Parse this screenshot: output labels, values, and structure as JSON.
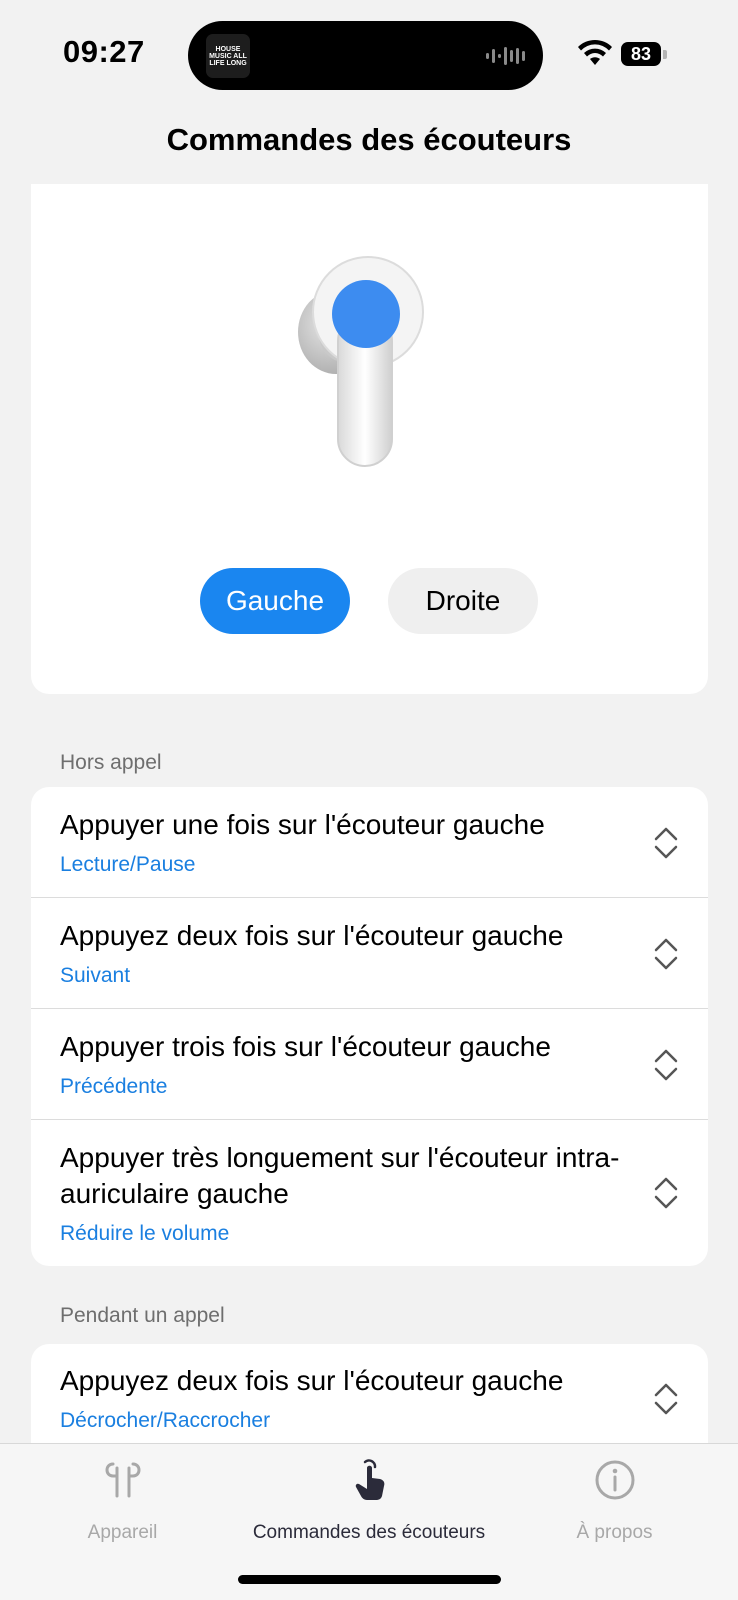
{
  "status_bar": {
    "time": "09:27",
    "album_text": "HOUSE MUSIC ALL LIFE LONG",
    "battery": "83"
  },
  "nav": {
    "title": "Commandes des écouteurs"
  },
  "selector": {
    "left_label": "Gauche",
    "right_label": "Droite",
    "selected": "Gauche",
    "accent_color": "#1a86f0"
  },
  "sections": [
    {
      "header": "Hors appel",
      "rows": [
        {
          "title": "Appuyer une fois sur l'écouteur gauche",
          "value": "Lecture/Pause"
        },
        {
          "title": "Appuyez deux fois sur l'écouteur gauche",
          "value": "Suivant"
        },
        {
          "title": "Appuyer trois fois sur l'écouteur gauche",
          "value": "Précédente"
        },
        {
          "title": "Appuyer très longuement sur l'écouteur intra-auriculaire gauche",
          "value": "Réduire le volume"
        }
      ]
    },
    {
      "header": "Pendant un appel",
      "rows": [
        {
          "title": "Appuyez deux fois sur l'écouteur gauche",
          "value": "Décrocher/Raccrocher"
        }
      ]
    }
  ],
  "tabs": [
    {
      "label": "Appareil",
      "icon": "earbuds-icon",
      "active": false
    },
    {
      "label": "Commandes des écouteurs",
      "icon": "tap-hand-icon",
      "active": true
    },
    {
      "label": "À propos",
      "icon": "info-icon",
      "active": false
    }
  ]
}
